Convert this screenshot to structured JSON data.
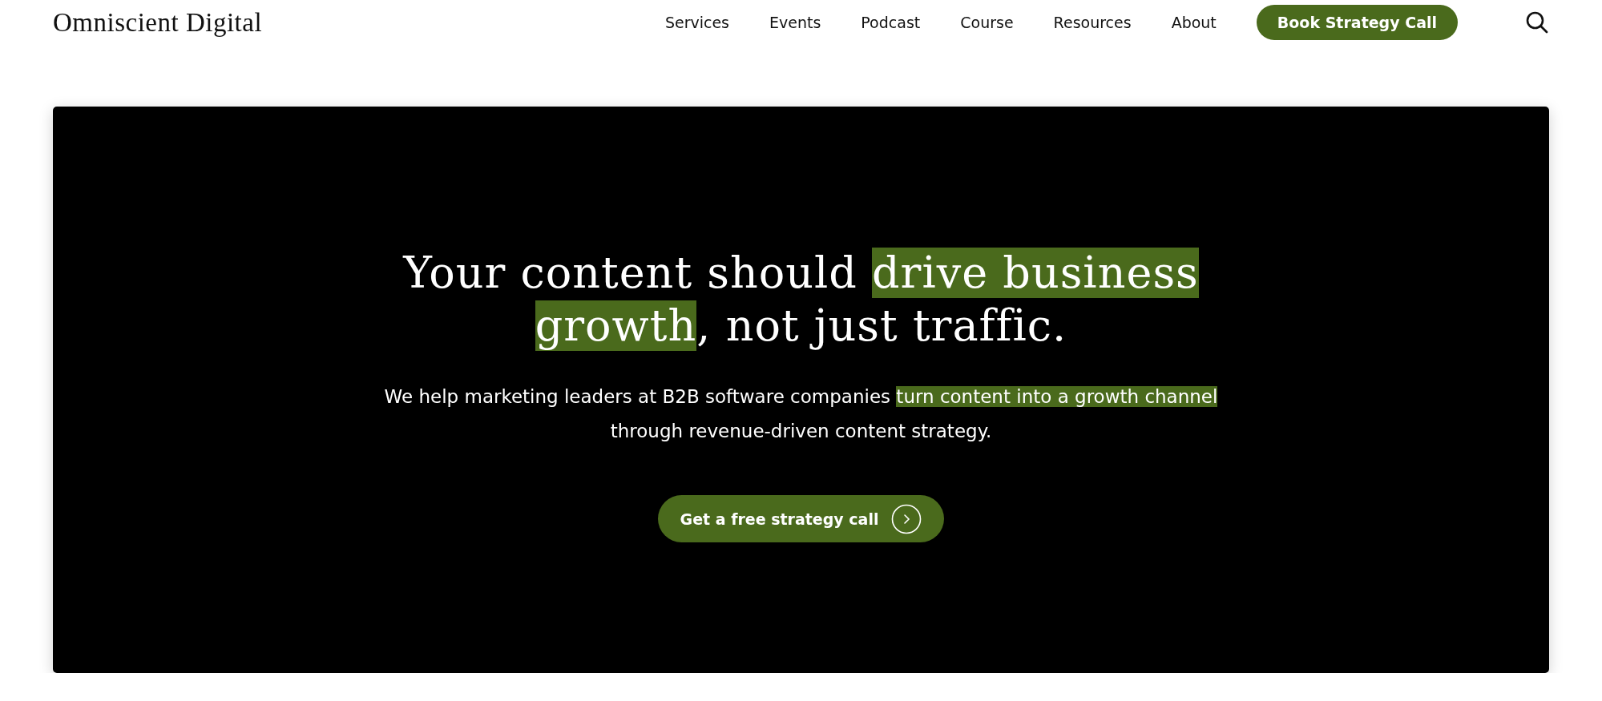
{
  "header": {
    "logo": "Omniscient Digital",
    "nav": [
      "Services",
      "Events",
      "Podcast",
      "Course",
      "Resources",
      "About"
    ],
    "cta": "Book Strategy Call"
  },
  "hero": {
    "headline": [
      [
        {
          "text": "Your content should ",
          "highlighted": false
        },
        {
          "text": "drive business",
          "highlighted": true
        }
      ],
      [
        {
          "text": "growth",
          "highlighted": true
        },
        {
          "text": ", not just traffic.",
          "highlighted": false
        }
      ]
    ],
    "subtitle": [
      [
        {
          "text": "We help marketing leaders at B2B software companies ",
          "highlighted": false
        },
        {
          "text": "turn content into a growth channel",
          "highlighted": true
        }
      ],
      [
        {
          "text": "through revenue-driven content strategy.",
          "highlighted": false
        }
      ]
    ],
    "button": "Get a free strategy call"
  }
}
